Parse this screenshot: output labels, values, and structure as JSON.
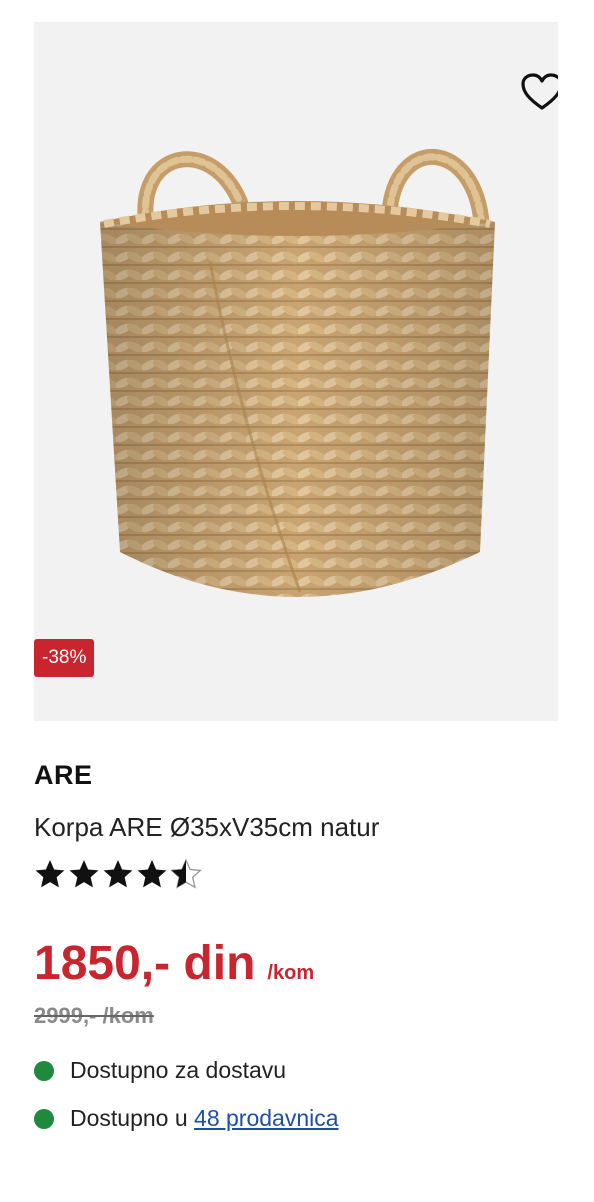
{
  "product": {
    "discount_badge": "-38%",
    "brand": "ARE",
    "name": "Korpa ARE Ø35xV35cm natur",
    "rating": 4.5,
    "price": "1850,- din",
    "price_unit": "/kom",
    "old_price": "2999,- /kom"
  },
  "availability": {
    "delivery": "Dostupno za dostavu",
    "stores_prefix": "Dostupno u",
    "stores_link": "48 prodavnica"
  },
  "colors": {
    "accent_red": "#c9252f",
    "available_green": "#1f8a3c",
    "link_blue": "#1e4fa5",
    "image_bg": "#f3f2f2"
  },
  "icons": {
    "wishlist": "heart-outline-icon",
    "rating": "star-icon",
    "status": "green-dot-icon"
  }
}
